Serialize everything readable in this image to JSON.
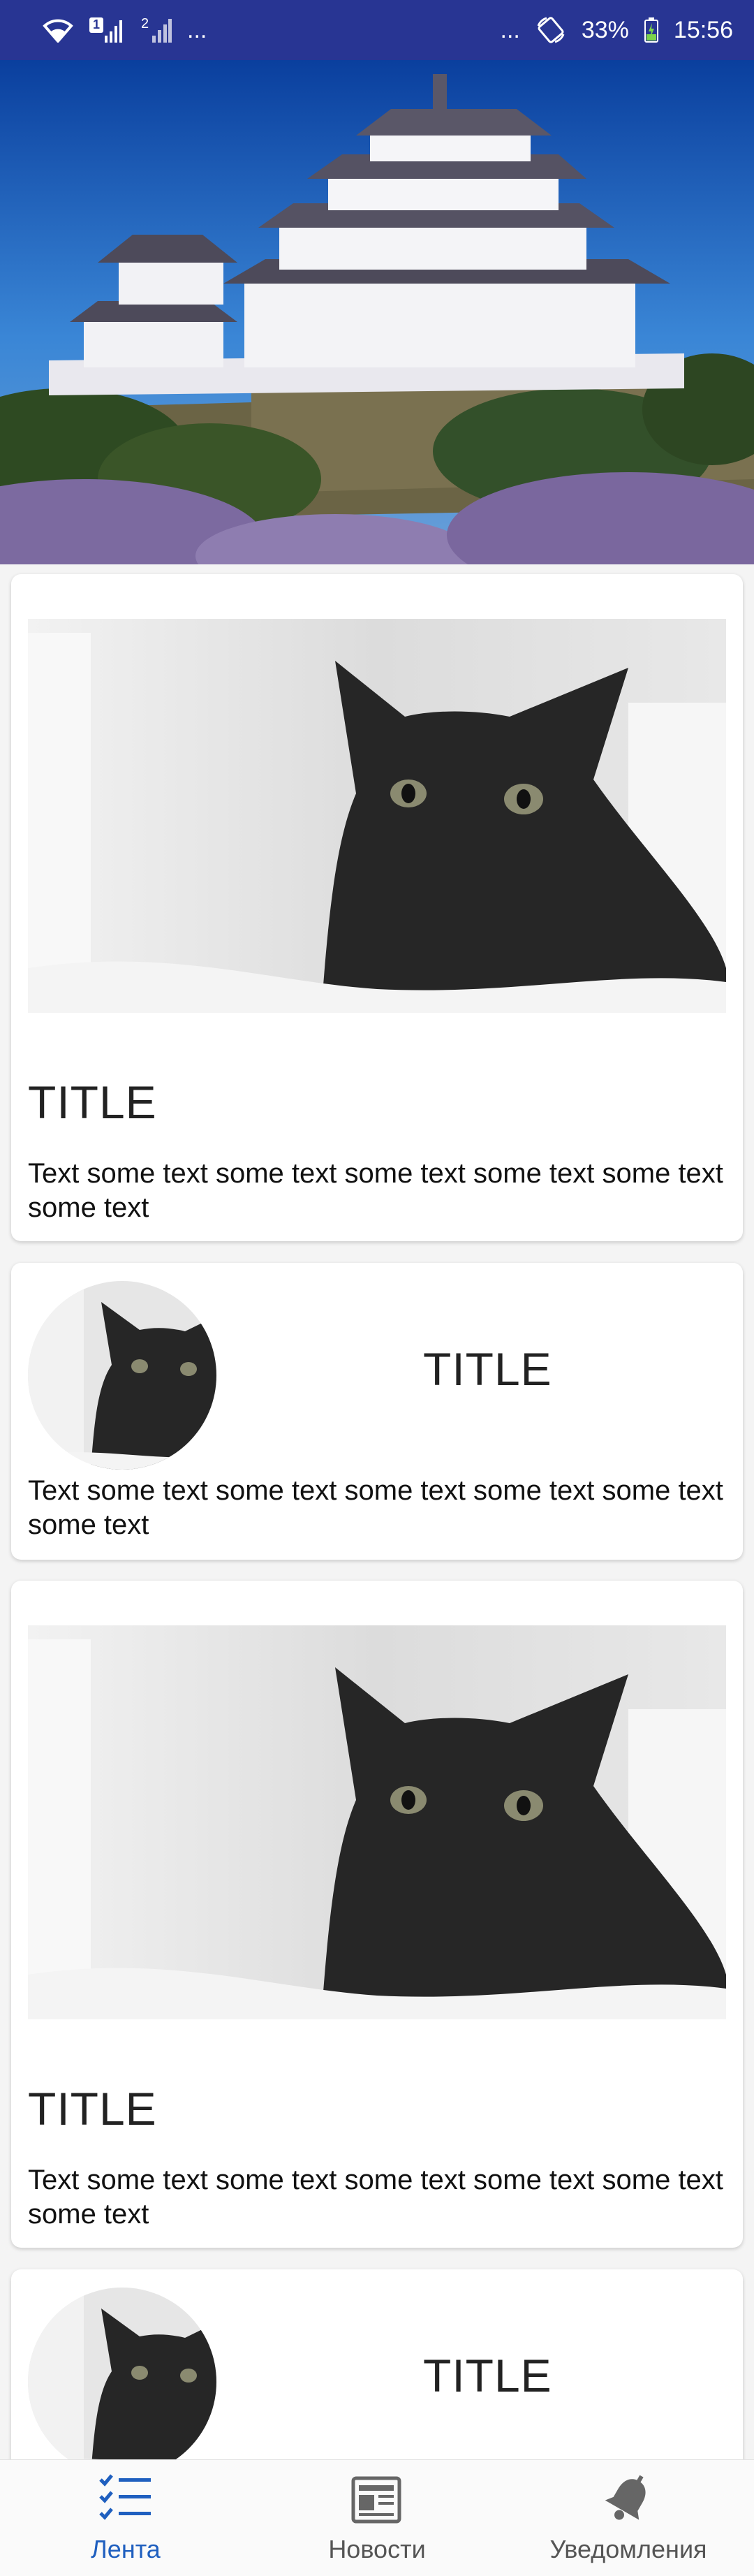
{
  "status_bar": {
    "dots_left": "...",
    "dots_right": "...",
    "sim1_badge": "1",
    "sim2_badge": "2",
    "battery": "33%",
    "time": "15:56",
    "icons": [
      "wifi-icon",
      "signal-sim1-icon",
      "signal-sim2-icon",
      "rotate-icon",
      "battery-icon"
    ]
  },
  "feed": {
    "cards": [
      {
        "type": "large",
        "title": "TITLE",
        "text": "Text some text some text some text some text some text some text"
      },
      {
        "type": "compact",
        "title": "TITLE",
        "text": "Text some text some text some text some text some text some text"
      },
      {
        "type": "large",
        "title": "TITLE",
        "text": "Text some text some text some text some text some text some text"
      },
      {
        "type": "compact",
        "title": "TITLE"
      }
    ]
  },
  "bottom_nav": {
    "items": [
      {
        "label": "Лента",
        "icon": "checklist-icon",
        "active": true
      },
      {
        "label": "Новости",
        "icon": "newspaper-icon",
        "active": false
      },
      {
        "label": "Уведомления",
        "icon": "bell-icon",
        "active": false
      }
    ],
    "colors": {
      "active": "#1f5fbf",
      "inactive": "#555555"
    }
  },
  "colors": {
    "status_bar": "#283593",
    "background": "#f4f4f4"
  }
}
